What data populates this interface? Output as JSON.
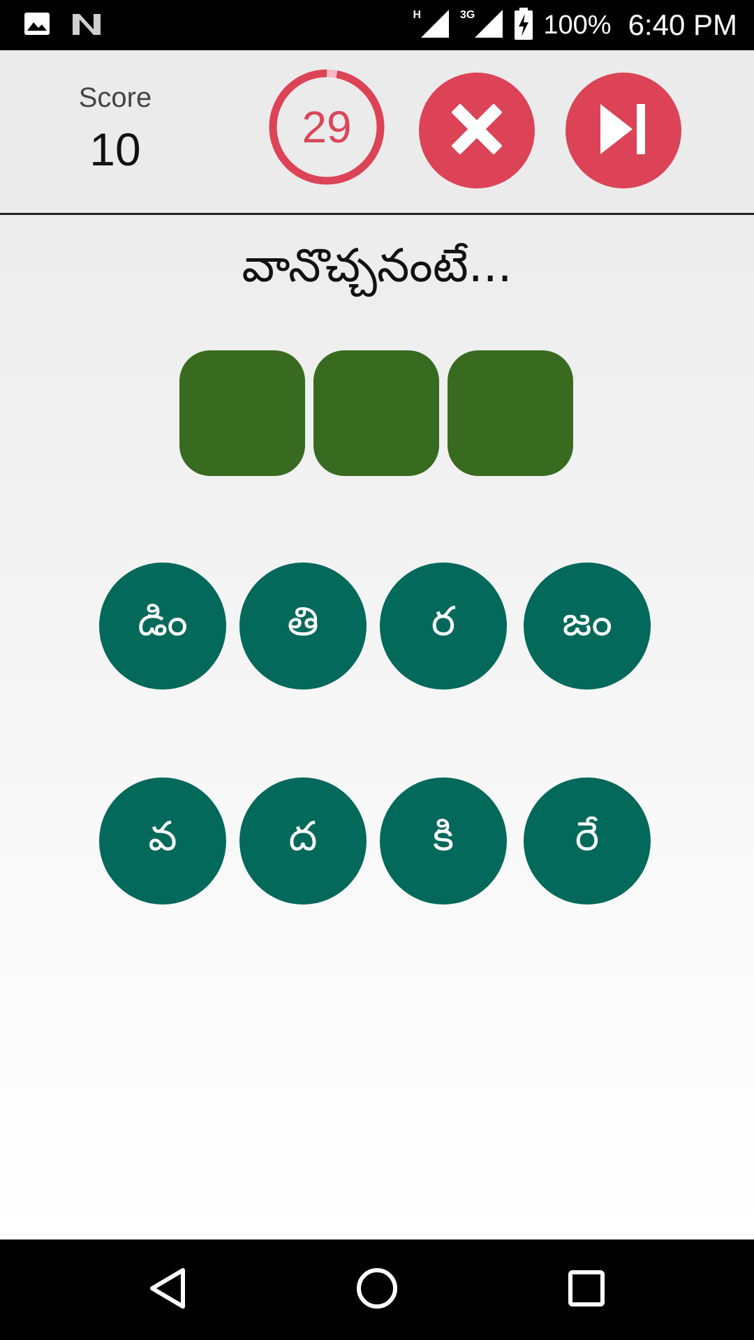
{
  "status_bar": {
    "network_type": "H",
    "network_type_2": "3G",
    "battery": "100%",
    "time": "6:40 PM"
  },
  "header": {
    "score_label": "Score",
    "score_value": "10",
    "timer_value": "29",
    "timer_progress": 0.97
  },
  "puzzle": {
    "clue": "వానొచ్చనంటే...",
    "answer_slots": 3
  },
  "tiles": {
    "row1": [
      "డిం",
      "తి",
      "ర",
      "జం"
    ],
    "row2": [
      "వ",
      "ద",
      "కి",
      "రే"
    ]
  },
  "colors": {
    "accent_red": "#dc4356",
    "slot_green": "#386b1f",
    "tile_teal": "#02695b"
  }
}
